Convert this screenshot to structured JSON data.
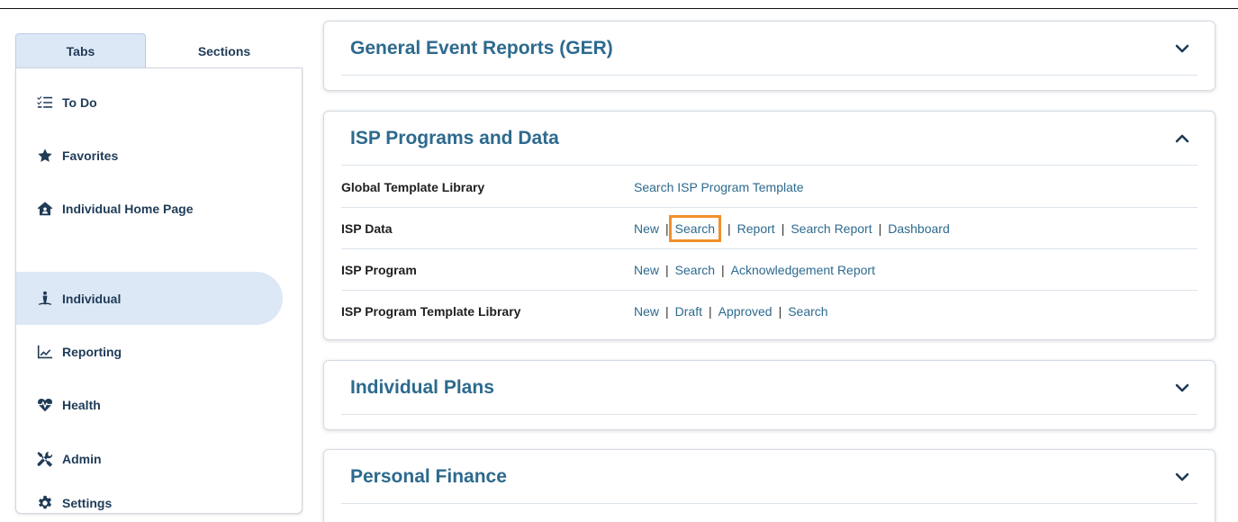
{
  "tabs": {
    "active": "Tabs",
    "inactive": "Sections"
  },
  "nav": [
    {
      "label": "To Do",
      "icon": "todo-list-icon"
    },
    {
      "label": "Favorites",
      "icon": "star-icon"
    },
    {
      "label": "Individual Home Page",
      "icon": "home-icon"
    },
    {
      "label": "Individual",
      "icon": "person-icon"
    },
    {
      "label": "Reporting",
      "icon": "chart-line-icon"
    },
    {
      "label": "Health",
      "icon": "heart-pulse-icon"
    },
    {
      "label": "Admin",
      "icon": "tools-icon"
    },
    {
      "label": "Settings",
      "icon": "gear-icon"
    }
  ],
  "active_nav": "Individual",
  "cards": {
    "ger": {
      "title": "General Event Reports (GER)",
      "expanded": false
    },
    "isp": {
      "title": "ISP Programs and Data",
      "expanded": true,
      "rows": [
        {
          "label": "Global Template Library",
          "links": [
            "Search ISP Program Template"
          ]
        },
        {
          "label": "ISP Data",
          "links": [
            "New",
            "Search",
            "Report",
            "Search Report",
            "Dashboard"
          ]
        },
        {
          "label": "ISP Program",
          "links": [
            "New",
            "Search",
            "Acknowledgement Report"
          ]
        },
        {
          "label": "ISP Program Template Library",
          "links": [
            "New",
            "Draft",
            "Approved",
            "Search"
          ]
        }
      ]
    },
    "plans": {
      "title": "Individual Plans",
      "expanded": false
    },
    "finance": {
      "title": "Personal Finance",
      "expanded": false
    }
  },
  "separator": "|",
  "highlight": {
    "row": "ISP Data",
    "link": "Search",
    "color": "#f0902a"
  }
}
